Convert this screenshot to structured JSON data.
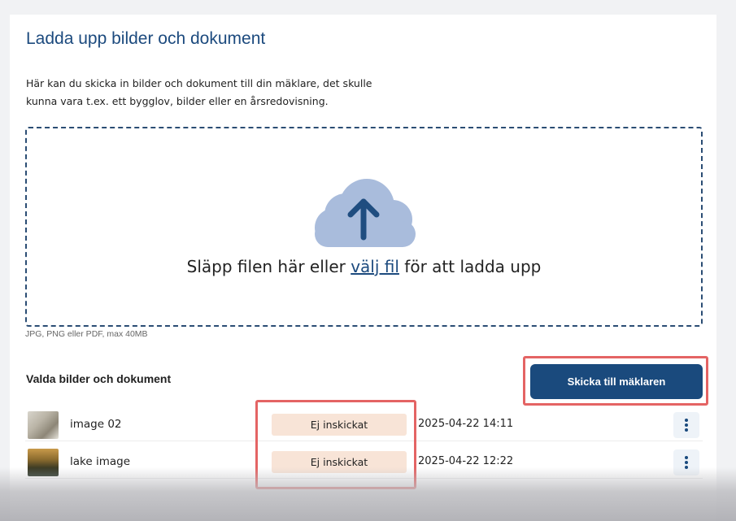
{
  "page": {
    "title": "Ladda upp bilder och dokument",
    "description": "Här kan du skicka in bilder och dokument till din mäklare, det skulle kunna vara t.ex. ett bygglov, bilder eller en årsredovisning."
  },
  "dropzone": {
    "text_before": "Släpp filen här eller ",
    "link_text": "välj fil",
    "text_after": " för att ladda upp",
    "hint": "JPG, PNG eller PDF, max 40MB",
    "icon": "cloud-upload-icon"
  },
  "files_section": {
    "title": "Valda bilder och dokument",
    "send_button_label": "Skicka till mäklaren",
    "files": [
      {
        "name": "image 02",
        "status": "Ej inskickat",
        "date": "2025-04-22 14:11",
        "thumbnail": "indoor-photo"
      },
      {
        "name": "lake image",
        "status": "Ej inskickat",
        "date": "2025-04-22 12:22",
        "thumbnail": "lake-photo"
      }
    ]
  },
  "colors": {
    "primary": "#1a4a7d",
    "title": "#1c4a7e",
    "status_badge_bg": "#f8e4d7",
    "highlight": "#e46464",
    "cloud": "#a9bcdc"
  }
}
